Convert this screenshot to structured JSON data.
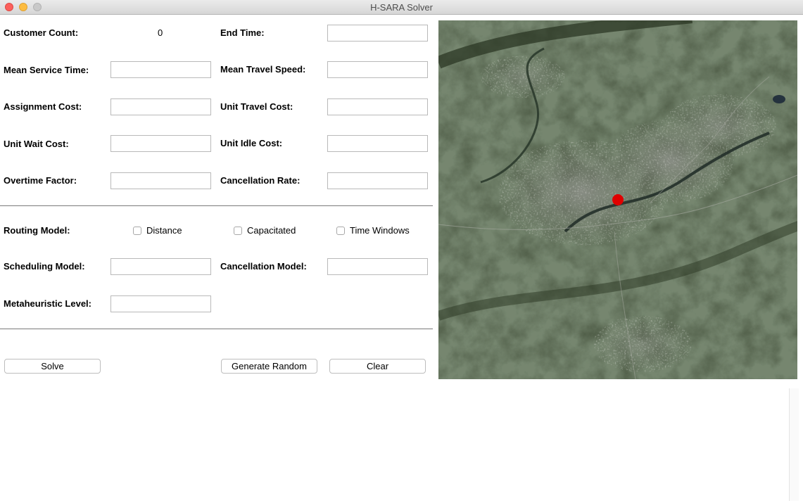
{
  "window": {
    "title": "H-SARA Solver"
  },
  "params": {
    "customer_count_label": "Customer Count:",
    "customer_count_value": "0",
    "end_time_label": "End Time:",
    "mean_service_time_label": "Mean Service Time:",
    "mean_travel_speed_label": "Mean Travel Speed:",
    "assignment_cost_label": "Assignment Cost:",
    "unit_travel_cost_label": "Unit Travel Cost:",
    "unit_wait_cost_label": "Unit Wait Cost:",
    "unit_idle_cost_label": "Unit Idle Cost:",
    "overtime_factor_label": "Overtime Factor:",
    "cancellation_rate_label": "Cancellation Rate:"
  },
  "models": {
    "routing_model_label": "Routing Model:",
    "options": [
      {
        "label": "Distance",
        "checked": false
      },
      {
        "label": "Capacitated",
        "checked": false
      },
      {
        "label": "Time Windows",
        "checked": false
      }
    ],
    "scheduling_model_label": "Scheduling Model:",
    "cancellation_model_label": "Cancellation Model:",
    "metaheuristic_level_label": "Metaheuristic Level:"
  },
  "buttons": {
    "solve": "Solve",
    "generate_random": "Generate Random",
    "clear": "Clear"
  },
  "map": {
    "type": "satellite",
    "marker_color": "#e00000"
  }
}
